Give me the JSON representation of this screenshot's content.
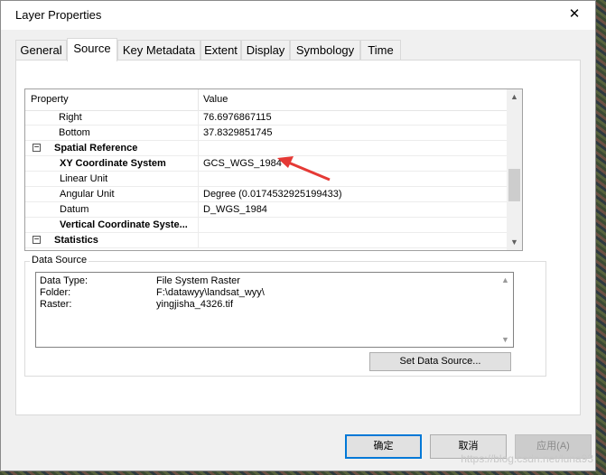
{
  "window": {
    "title": "Layer Properties",
    "close_glyph": "✕"
  },
  "tabs": [
    "General",
    "Source",
    "Key Metadata",
    "Extent",
    "Display",
    "Symbology",
    "Time"
  ],
  "grid": {
    "col_property": "Property",
    "col_value": "Value",
    "rows": [
      {
        "key": "Right",
        "value": "76.6976867115"
      },
      {
        "key": "Bottom",
        "value": "37.8329851745"
      },
      {
        "key": "Spatial Reference",
        "value": "",
        "section": true,
        "expander": "−"
      },
      {
        "key": "XY Coordinate System",
        "value": "GCS_WGS_1984",
        "bold": true
      },
      {
        "key": "Linear Unit",
        "value": ""
      },
      {
        "key": "Angular Unit",
        "value": "Degree (0.0174532925199433)"
      },
      {
        "key": "Datum",
        "value": "D_WGS_1984"
      },
      {
        "key": "Vertical Coordinate Syste...",
        "value": "",
        "bold": true
      },
      {
        "key": "Statistics",
        "value": "",
        "section": true,
        "expander": "−"
      }
    ],
    "scroll_up": "▲",
    "scroll_down": "▼"
  },
  "data_source": {
    "legend": "Data Source",
    "lines": [
      {
        "label": "Data Type:",
        "value": "File System Raster"
      },
      {
        "label": "Folder:",
        "value": "F:\\datawyy\\landsat_wyy\\"
      },
      {
        "label": "Raster:",
        "value": "yingjisha_4326.tif"
      }
    ],
    "set_button": "Set Data Source..."
  },
  "buttons": {
    "ok": "确定",
    "cancel": "取消",
    "apply": "应用(A)"
  },
  "watermark": "https://blog.csdn.net/luna93",
  "colors": {
    "accent": "#0078d7",
    "annotation_arrow": "#e53935"
  }
}
